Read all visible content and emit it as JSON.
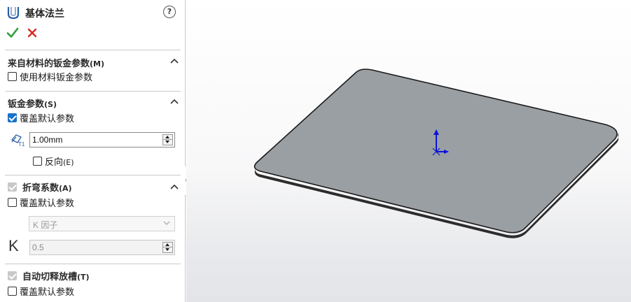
{
  "header": {
    "title": "基体法兰",
    "icon": "base-flange-icon",
    "help_label": "?",
    "ok_icon": "check-icon",
    "cancel_icon": "close-icon"
  },
  "groups": {
    "material": {
      "title": "来自材料的钣金参数",
      "accel": "(M)",
      "checkbox_label": "使用材料钣金参数",
      "checked": false
    },
    "sheet_metal": {
      "title": "钣金参数",
      "accel": "(S)",
      "override_label": "覆盖默认参数",
      "override_checked": true,
      "thickness_icon": "thickness-icon",
      "thickness_value": "1.00mm",
      "reverse_label": "反向",
      "reverse_accel": "(E)",
      "reverse_checked": false
    },
    "bend_allowance": {
      "title": "折弯系数",
      "accel": "(A)",
      "override_label": "覆盖默认参数",
      "override_checked": false,
      "type_value": "K 因子",
      "k_label": "K",
      "k_value": "0.5"
    },
    "auto_relief": {
      "title": "自动切释放槽",
      "accel": "(T)",
      "override_label": "覆盖默认参数",
      "override_checked": false
    }
  },
  "colors": {
    "accent": "#1a73c8",
    "ok_green": "#2e9e3a",
    "cancel_red": "#d42a1f",
    "plate_fill": "#9a9fa3",
    "triad_blue": "#0a14d8"
  }
}
